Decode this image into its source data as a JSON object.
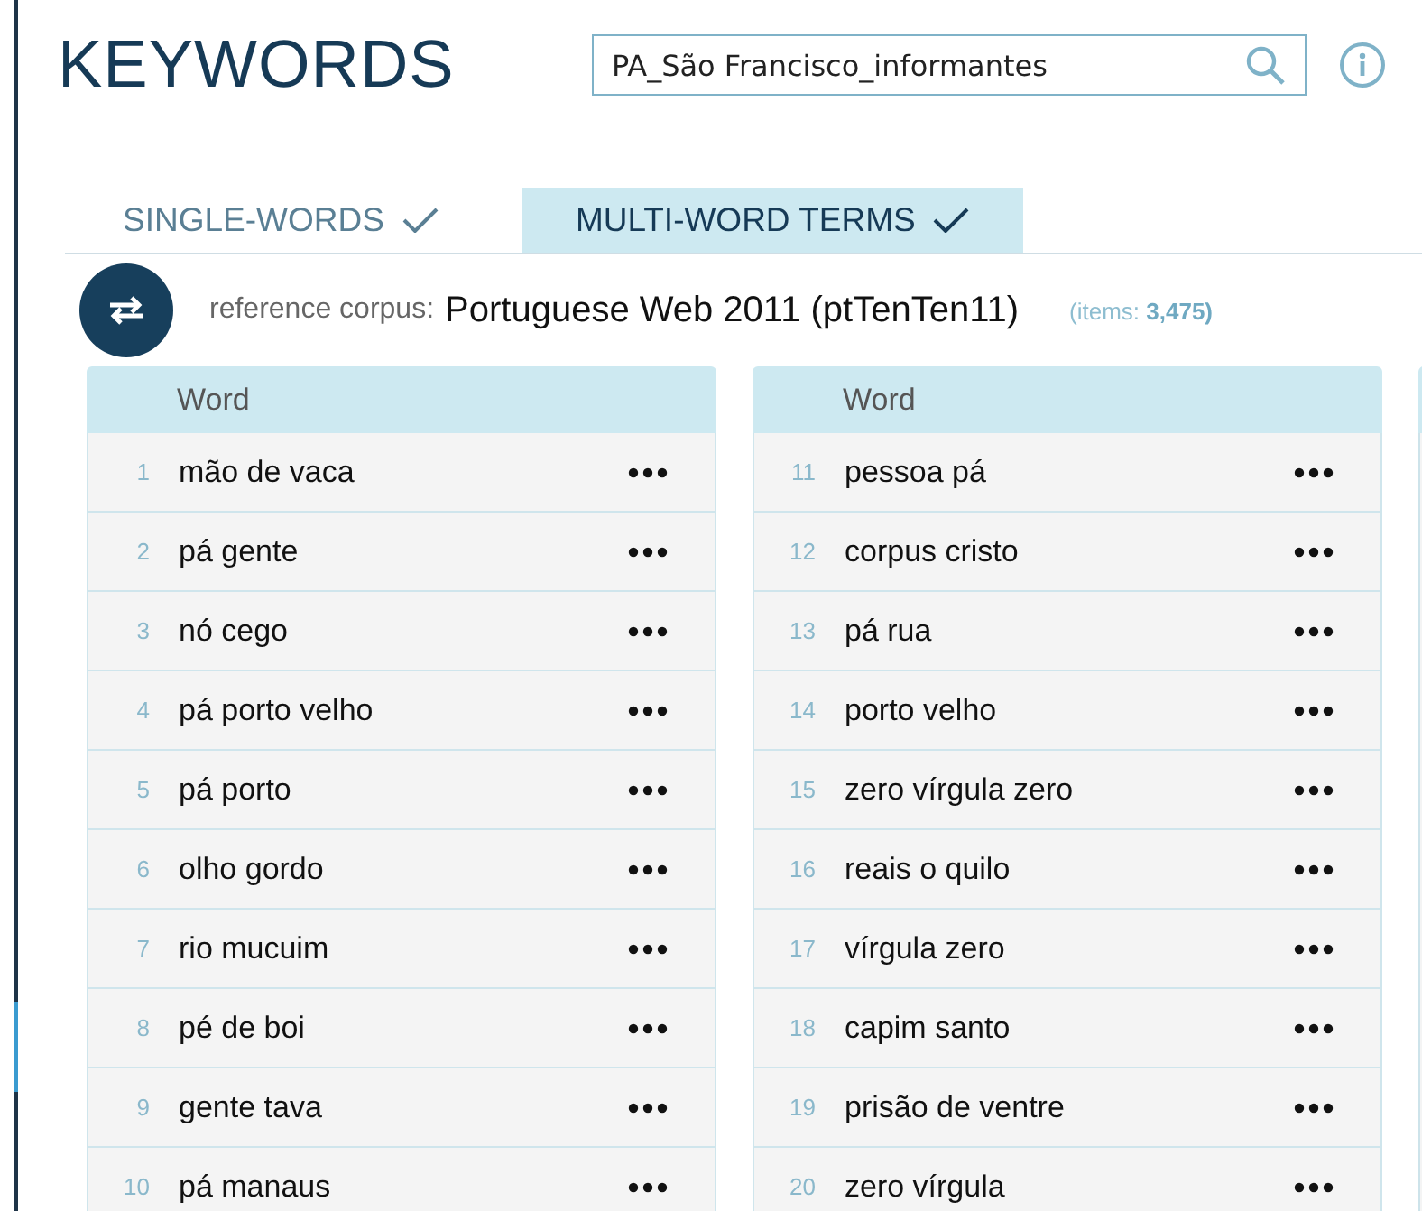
{
  "title": "KEYWORDS",
  "search": {
    "value": "PA_São Francisco_informantes"
  },
  "tabs": [
    {
      "label": "SINGLE-WORDS",
      "selected": false
    },
    {
      "label": "MULTI-WORD TERMS",
      "selected": true
    }
  ],
  "reference": {
    "label": "reference corpus:",
    "corpus": "Portuguese Web 2011 (ptTenTen11)",
    "items_label": "(items: ",
    "items_count": "3,475)"
  },
  "tables": [
    {
      "column": "Word",
      "rows": [
        {
          "rank": "1",
          "word": "mão de vaca"
        },
        {
          "rank": "2",
          "word": "pá gente"
        },
        {
          "rank": "3",
          "word": "nó cego"
        },
        {
          "rank": "4",
          "word": "pá porto velho"
        },
        {
          "rank": "5",
          "word": "pá porto"
        },
        {
          "rank": "6",
          "word": "olho gordo"
        },
        {
          "rank": "7",
          "word": "rio mucuim"
        },
        {
          "rank": "8",
          "word": "pé de boi"
        },
        {
          "rank": "9",
          "word": "gente tava"
        },
        {
          "rank": "10",
          "word": "pá manaus"
        }
      ]
    },
    {
      "column": "Word",
      "rows": [
        {
          "rank": "11",
          "word": "pessoa pá"
        },
        {
          "rank": "12",
          "word": "corpus cristo"
        },
        {
          "rank": "13",
          "word": "pá rua"
        },
        {
          "rank": "14",
          "word": "porto velho"
        },
        {
          "rank": "15",
          "word": "zero vírgula zero"
        },
        {
          "rank": "16",
          "word": "reais o quilo"
        },
        {
          "rank": "17",
          "word": "vírgula zero"
        },
        {
          "rank": "18",
          "word": "capim santo"
        },
        {
          "rank": "19",
          "word": "prisão de ventre"
        },
        {
          "rank": "20",
          "word": "zero vírgula"
        }
      ]
    }
  ]
}
